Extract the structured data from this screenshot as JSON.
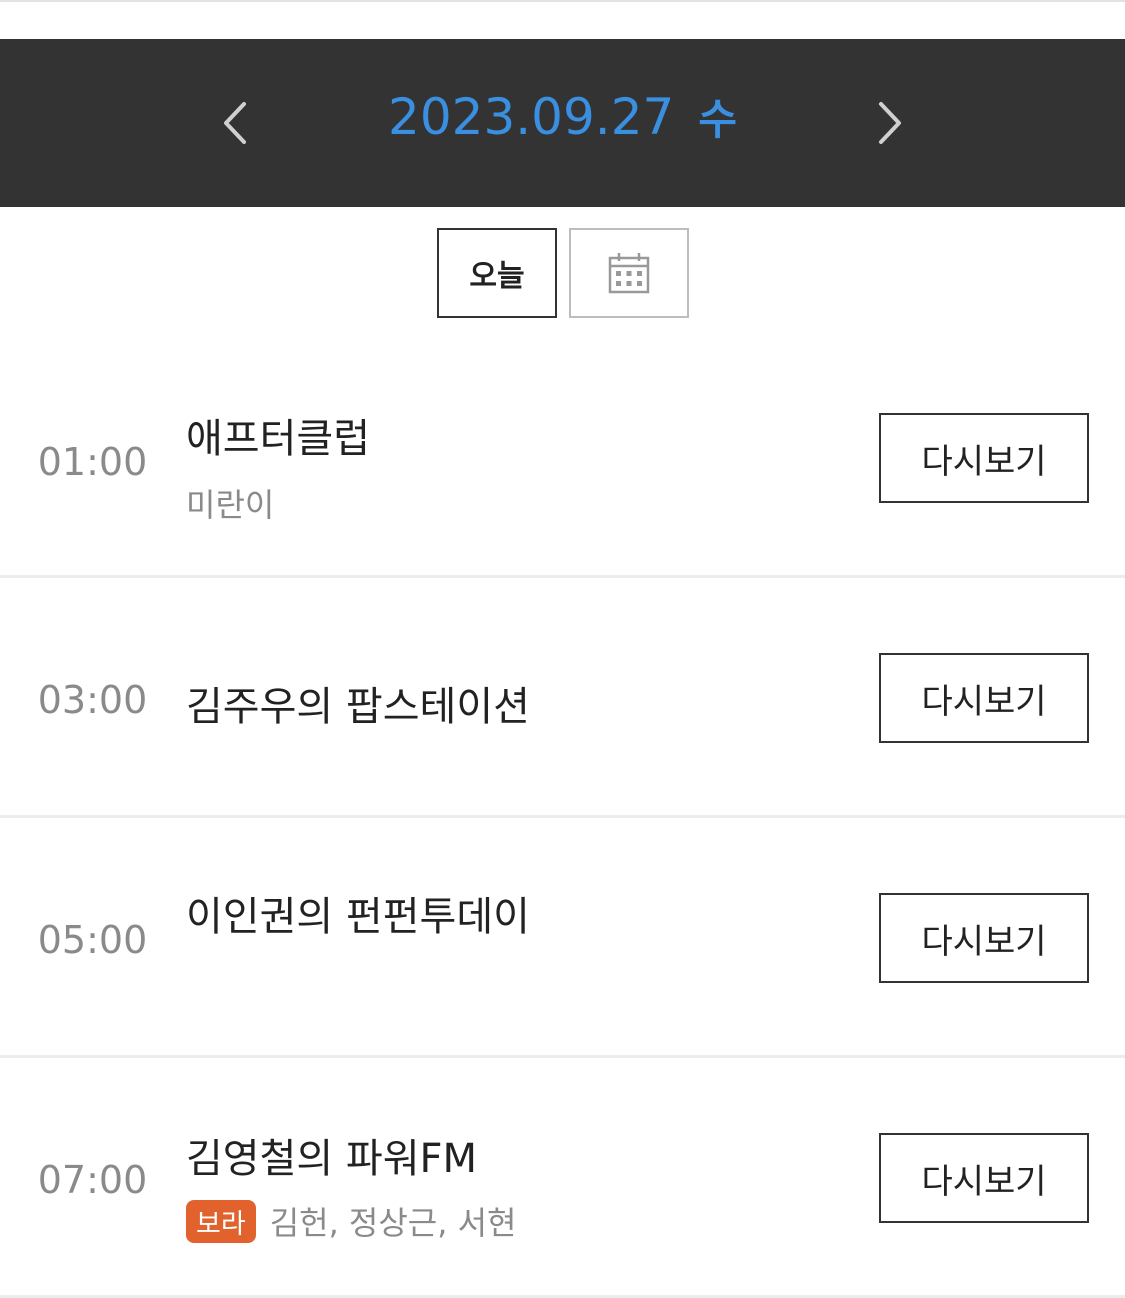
{
  "header": {
    "date": "2023.09.27",
    "weekday": "수",
    "accent_color": "#3a8fe0",
    "prev_icon": "chevron-left-icon",
    "next_icon": "chevron-right-icon"
  },
  "controls": {
    "today_label": "오늘",
    "calendar_icon": "calendar-icon"
  },
  "schedule": [
    {
      "time": "01:00",
      "title": "애프터클럽",
      "host": "미란이",
      "badge": "",
      "action_label": "다시보기"
    },
    {
      "time": "03:00",
      "title": "김주우의 팝스테이션",
      "host": "",
      "badge": "",
      "action_label": "다시보기"
    },
    {
      "time": "05:00",
      "title": "이인권의 펀펀투데이",
      "host": "",
      "badge": "",
      "action_label": "다시보기"
    },
    {
      "time": "07:00",
      "title": "김영철의 파워FM",
      "host": "김헌, 정상근, 서현",
      "badge": "보라",
      "action_label": "다시보기"
    }
  ],
  "colors": {
    "bar_bg": "#333333",
    "badge_bg": "#e1622d"
  }
}
